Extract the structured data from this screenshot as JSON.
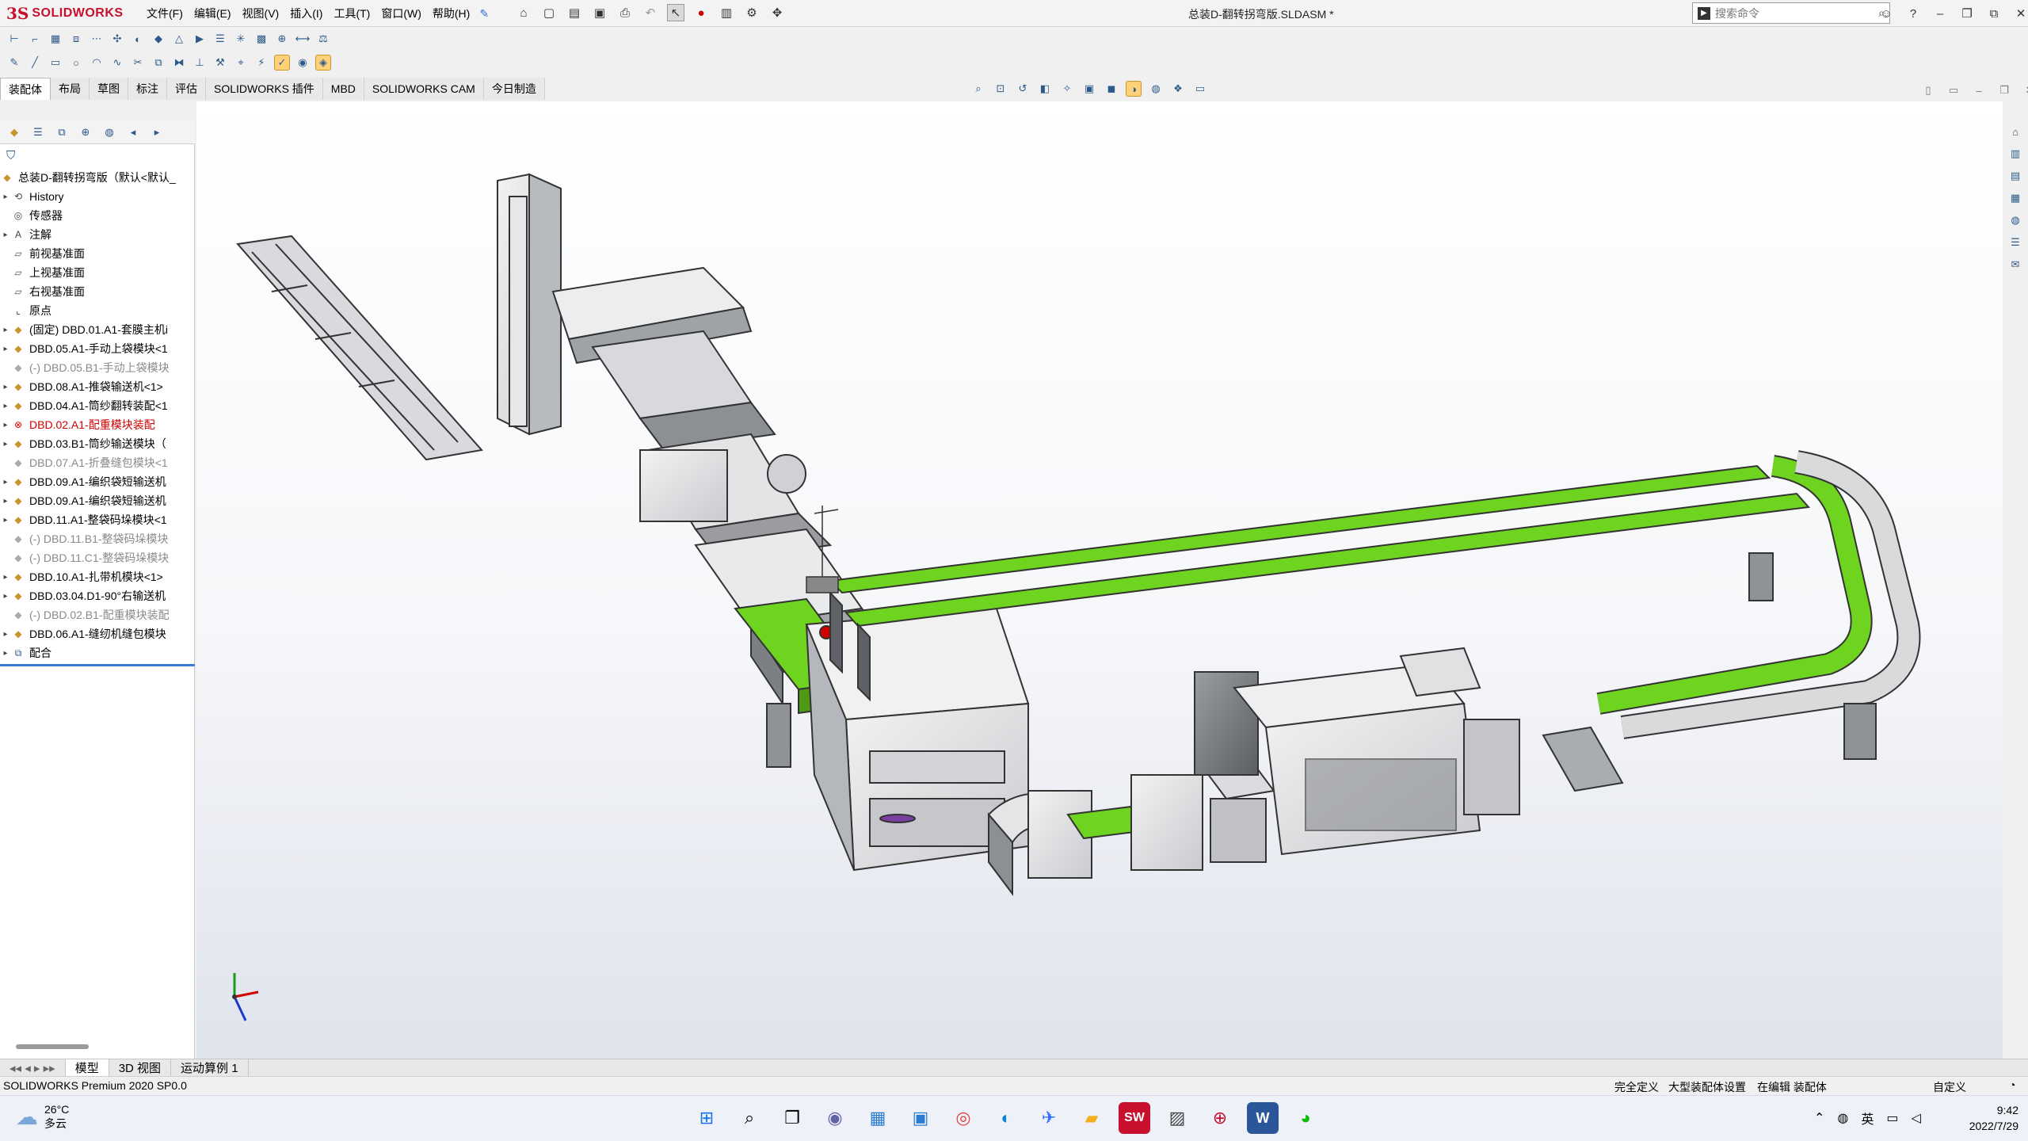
{
  "app": {
    "logo_ds": "3S",
    "logo_text": "SOLIDWORKS",
    "doc_title": "总装D-翻转拐弯版.SLDASM *",
    "search_placeholder": "搜索命令",
    "help_label": "?"
  },
  "menus": [
    "文件(F)",
    "编辑(E)",
    "视图(V)",
    "插入(I)",
    "工具(T)",
    "窗口(W)",
    "帮助(H)"
  ],
  "command_tabs": [
    "装配体",
    "布局",
    "草图",
    "标注",
    "评估",
    "SOLIDWORKS 插件",
    "MBD",
    "SOLIDWORKS CAM",
    "今日制造"
  ],
  "feature_tree": {
    "root": "总装D-翻转拐弯版（默认<默认_",
    "items": [
      {
        "label": "History",
        "icon": "history-icon",
        "state": "normal",
        "expand": true
      },
      {
        "label": "传感器",
        "icon": "sensor-icon",
        "state": "normal",
        "expand": false
      },
      {
        "label": "注解",
        "icon": "annotation-icon",
        "state": "normal",
        "expand": true
      },
      {
        "label": "前视基准面",
        "icon": "plane-icon",
        "state": "normal",
        "expand": false
      },
      {
        "label": "上视基准面",
        "icon": "plane-icon",
        "state": "normal",
        "expand": false
      },
      {
        "label": "右视基准面",
        "icon": "plane-icon",
        "state": "normal",
        "expand": false
      },
      {
        "label": "原点",
        "icon": "origin-icon",
        "state": "normal",
        "expand": false
      },
      {
        "label": "(固定) DBD.01.A1-套膜主机i",
        "icon": "assembly-icon",
        "state": "normal",
        "expand": true
      },
      {
        "label": "DBD.05.A1-手动上袋模块<1",
        "icon": "assembly-icon",
        "state": "normal",
        "expand": true
      },
      {
        "label": "(-) DBD.05.B1-手动上袋模块",
        "icon": "assembly-icon",
        "state": "dim",
        "expand": false
      },
      {
        "label": "DBD.08.A1-推袋输送机<1>",
        "icon": "assembly-icon",
        "state": "normal",
        "expand": true
      },
      {
        "label": "DBD.04.A1-筒纱翻转装配<1",
        "icon": "assembly-icon",
        "state": "normal",
        "expand": true
      },
      {
        "label": "DBD.02.A1-配重模块装配",
        "icon": "error-icon",
        "state": "err",
        "expand": true
      },
      {
        "label": "DBD.03.B1-筒纱输送模块（",
        "icon": "assembly-icon",
        "state": "normal",
        "expand": true
      },
      {
        "label": "DBD.07.A1-折叠缝包模块<1",
        "icon": "assembly-icon",
        "state": "dim",
        "expand": false
      },
      {
        "label": "DBD.09.A1-编织袋短输送机",
        "icon": "assembly-icon",
        "state": "normal",
        "expand": true
      },
      {
        "label": "DBD.09.A1-编织袋短输送机",
        "icon": "assembly-icon",
        "state": "normal",
        "expand": true
      },
      {
        "label": "DBD.11.A1-整袋码垛模块<1",
        "icon": "assembly-icon",
        "state": "normal",
        "expand": true
      },
      {
        "label": "(-) DBD.11.B1-整袋码垛模块",
        "icon": "assembly-icon",
        "state": "dim",
        "expand": false
      },
      {
        "label": "(-) DBD.11.C1-整袋码垛模块",
        "icon": "assembly-icon",
        "state": "dim",
        "expand": false
      },
      {
        "label": "DBD.10.A1-扎带机模块<1>",
        "icon": "assembly-icon",
        "state": "normal",
        "expand": true
      },
      {
        "label": "DBD.03.04.D1-90°右输送机",
        "icon": "assembly-icon",
        "state": "normal",
        "expand": true
      },
      {
        "label": "(-) DBD.02.B1-配重模块装配",
        "icon": "assembly-icon",
        "state": "dim",
        "expand": false
      },
      {
        "label": "DBD.06.A1-缝纫机缝包模块",
        "icon": "assembly-icon",
        "state": "normal",
        "expand": true
      },
      {
        "label": "配合",
        "icon": "mates-icon",
        "state": "normal",
        "expand": true
      }
    ]
  },
  "bottom_tabs": [
    "模型",
    "3D 视图",
    "运动算例 1"
  ],
  "status": {
    "left": "SOLIDWORKS Premium 2020 SP0.0",
    "defined": "完全定义",
    "assembly_settings": "大型装配体设置",
    "editing": "在编辑 装配体",
    "units": "自定义"
  },
  "taskbar": {
    "temperature": "26°C",
    "weather": "多云",
    "ime": "英",
    "time": "9:42",
    "date": "2022/7/29"
  },
  "colors": {
    "accent_red": "#c8102e",
    "conveyor_green": "#6fd41f",
    "frame_gray": "#8f9296",
    "selected_tab": "#ffffff"
  }
}
